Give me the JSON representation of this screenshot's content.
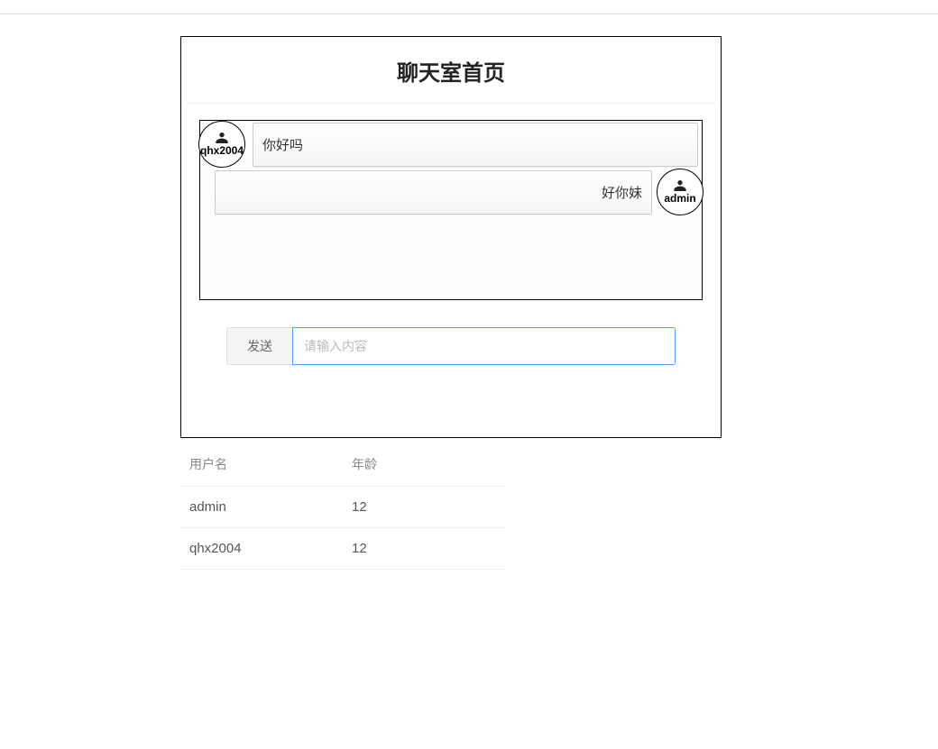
{
  "header": {
    "title": "聊天室首页"
  },
  "chat": {
    "messages": [
      {
        "user": "qhx2004",
        "text": "你好吗",
        "side": "left"
      },
      {
        "user": "admin",
        "text": "好你妹",
        "side": "right"
      }
    ]
  },
  "input": {
    "send_label": "发送",
    "placeholder": "请输入内容"
  },
  "user_table": {
    "columns": [
      "用户名",
      "年龄"
    ],
    "rows": [
      {
        "username": "admin",
        "age": "12"
      },
      {
        "username": "qhx2004",
        "age": "12"
      }
    ]
  }
}
